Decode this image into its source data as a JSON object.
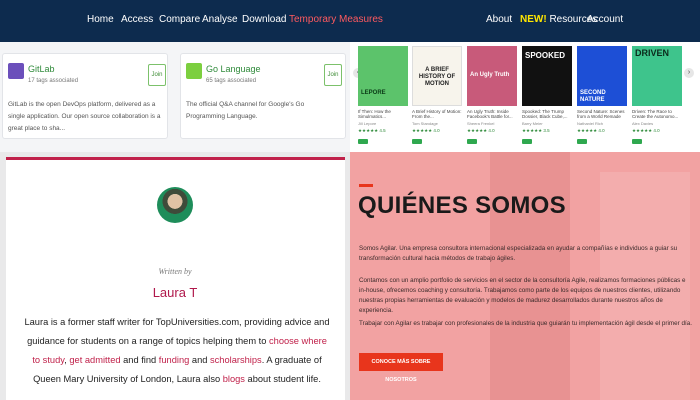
{
  "nav": {
    "left": [
      "Home",
      "Access",
      "Compare",
      "Analyse",
      "Download",
      "Temporary Measures"
    ],
    "about": "About",
    "new_badge": "NEW!",
    "resources": "Resources",
    "account": "Account",
    "bg_color": "#0d2b4e",
    "highlight_color": "#ff5a5f"
  },
  "tag_cards": [
    {
      "name": "GitLab",
      "tags": "17 tags associated",
      "join": "Join",
      "description": "GitLab is the open DevOps platform, delivered as a single application. Our open source collaboration is a great place to sha...",
      "logo_color": "#6b4fbb"
    },
    {
      "name": "Go Language",
      "tags": "65 tags associated",
      "join": "Join",
      "description": "The official Q&A channel for Google's Go Programming Language.",
      "logo_color": "#7ccf3f"
    }
  ],
  "books": {
    "prev_icon": "‹",
    "next_icon": "›",
    "items": [
      {
        "cover": "LEPORE",
        "title": "If Then: How the Simulmatics...",
        "author": "Jill Lepore",
        "rating": "★★★★★ 4.5",
        "cover_color": "#5cc36b"
      },
      {
        "cover": "A BRIEF HISTORY OF MOTION",
        "title": "A Brief History of Motion: From the...",
        "author": "Tom Standage",
        "rating": "★★★★★ 4.0",
        "cover_color": "#f7f4ec"
      },
      {
        "cover": "An Ugly Truth",
        "title": "An Ugly Truth: Inside Facebook's Battle for...",
        "author": "Sheera Frenkel",
        "rating": "★★★★★ 4.0",
        "cover_color": "#c85a7a"
      },
      {
        "cover": "SPOOKED",
        "title": "Spooked: The Trump Dossier, Black Cube,...",
        "author": "Barry Meier",
        "rating": "★★★★★ 3.5",
        "cover_color": "#111111"
      },
      {
        "cover": "SECOND NATURE",
        "title": "Second Nature: Scenes from a World Remade",
        "author": "Nathaniel Rich",
        "rating": "★★★★★ 4.0",
        "cover_color": "#1d4fd6"
      },
      {
        "cover": "DRIVEN",
        "title": "Driven: The Race to Create the Autonomo...",
        "author": "Alex Davies",
        "rating": "★★★★★ 4.0",
        "cover_color": "#3ec48c"
      }
    ]
  },
  "article": {
    "written_by": "Written by",
    "author": "Laura T",
    "bio_1": "Laura is a former staff writer for TopUniversities.com, providing advice and guidance for students on a range of topics helping them to ",
    "link_choose": "choose where to study",
    "comma": ", ",
    "link_admitted": "get admitted",
    "and_find": " and find ",
    "link_funding": "funding",
    "and": " and ",
    "link_scholarships": "scholarships",
    "bio_2": ". A graduate of Queen Mary University of London, Laura also ",
    "link_blogs": "blogs",
    "bio_3": " about student life.",
    "accent_color": "#c0214a"
  },
  "quienes": {
    "heading": "QUIÉNES SOMOS",
    "p1": "Somos Agilar. Una empresa consultora internacional especializada en ayudar a compañías e individuos a guiar su transformación cultural hacia métodos de trabajo ágiles.",
    "p2": "Contamos con un amplio portfolio de servicios en el sector de la consultoría Agile, realizamos formaciones públicas e in-house, ofrecemos coaching y consultoría. Trabajamos como parte de los equipos de nuestros clientes, utilizando nuestras propias herramientas de evaluación y modelos de madurez desarrollados durante nuestros años de experiencia.",
    "p3": "Trabajar con Agilar es trabajar con profesionales de la industria que guiarán tu implementación ágil desde el primer día.",
    "cta": "CONOCE MÁS SOBRE NOSOTROS",
    "accent_color": "#e8351c"
  }
}
